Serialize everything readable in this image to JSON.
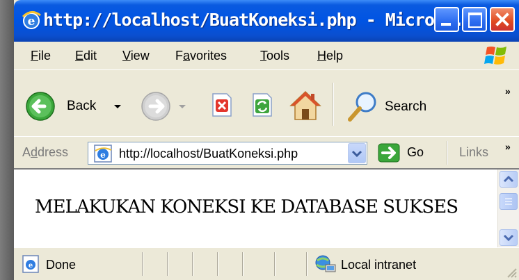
{
  "window": {
    "title": "http://localhost/BuatKoneksi.php - Micro...",
    "colors": {
      "titlebar": "#0054e3",
      "close": "#e04a1f",
      "chrome": "#ece9d8"
    }
  },
  "menu": {
    "items": [
      {
        "pre": "",
        "u": "F",
        "post": "ile"
      },
      {
        "pre": "",
        "u": "E",
        "post": "dit"
      },
      {
        "pre": "",
        "u": "V",
        "post": "iew"
      },
      {
        "pre": "F",
        "u": "a",
        "post": "vorites"
      },
      {
        "pre": "",
        "u": "T",
        "post": "ools"
      },
      {
        "pre": "",
        "u": "H",
        "post": "elp"
      }
    ]
  },
  "toolbar": {
    "back_label": "Back",
    "search_label": "Search",
    "icons": [
      "back-icon",
      "forward-icon",
      "stop-icon",
      "refresh-icon",
      "home-icon",
      "search-icon"
    ]
  },
  "address": {
    "label_pre": "A",
    "label_u": "d",
    "label_post": "dress",
    "url": "http://localhost/BuatKoneksi.php",
    "go_label": "Go",
    "links_label": "Links"
  },
  "content": {
    "message": "MELAKUKAN KONEKSI KE DATABASE SUKSES"
  },
  "status": {
    "text": "Done",
    "zone": "Local intranet"
  }
}
